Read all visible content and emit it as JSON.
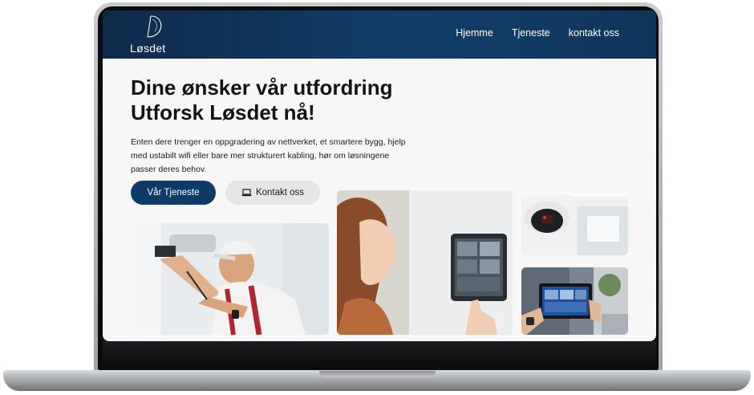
{
  "header": {
    "logo_text": "Løsdet",
    "nav": [
      "Hjemme",
      "Tjeneste",
      "kontakt oss"
    ]
  },
  "hero": {
    "title_line1": "Dine ønsker vår utfordring",
    "title_line2": "Utforsk Løsdet nå!",
    "description": "Enten dere trenger en oppgradering av nettverket, et smartere bygg, hjelp med ustabilt wifi eller bare mer strukturert kabling, hør om løsningene passer deres behov.",
    "primary_button": "Vår Tjeneste",
    "secondary_button": "Kontakt oss"
  },
  "images": [
    {
      "name": "technician-installing-camera"
    },
    {
      "name": "woman-using-wall-control-panel"
    },
    {
      "name": "security-dome-camera"
    },
    {
      "name": "hand-holding-tablet-camera-feeds"
    }
  ],
  "colors": {
    "header_bg": "#0e2a4a",
    "primary": "#0e3a68",
    "secondary_btn_bg": "#e6e6e6",
    "page_bg": "#f7f7f7"
  }
}
